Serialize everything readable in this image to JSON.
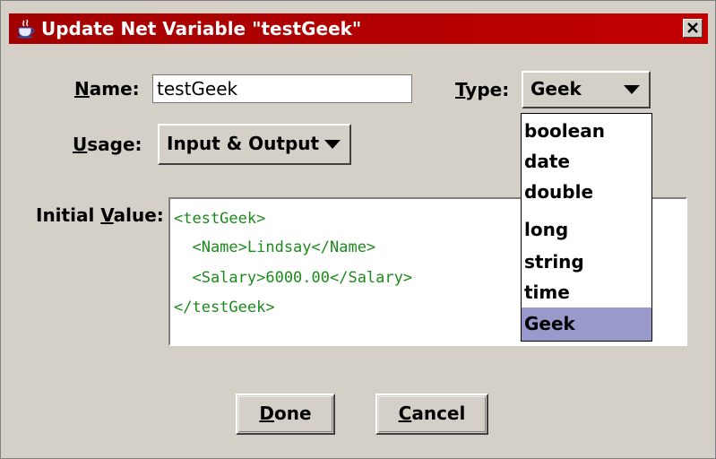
{
  "window": {
    "title": "Update Net Variable \"testGeek\"",
    "icon": "java-cup-icon",
    "close_icon": "close-icon"
  },
  "form": {
    "name_label_accel": "N",
    "name_label_rest": "ame:",
    "name_value": "testGeek",
    "type_label_accel": "T",
    "type_label_rest": "ype:",
    "type_value": "Geek",
    "usage_label_accel": "U",
    "usage_label_rest": "sage:",
    "usage_value": "Input & Output",
    "initial_label_pre": "Initial ",
    "initial_label_accel": "V",
    "initial_label_rest": "alue:"
  },
  "initial_value": {
    "lines": [
      "<testGeek>",
      "  <Name>Lindsay</Name>",
      "  <Salary>6000.00</Salary>",
      "</testGeek>"
    ]
  },
  "type_dropdown": {
    "options": [
      "boolean",
      "date",
      "double",
      "long",
      "string",
      "time",
      "Geek"
    ],
    "selected": "Geek"
  },
  "buttons": {
    "done_accel": "D",
    "done_rest": "one",
    "cancel_accel": "C",
    "cancel_rest": "ancel"
  },
  "colors": {
    "titlebar": "#b00000",
    "code_text": "#1c8a1c",
    "selection": "#9999cc"
  }
}
